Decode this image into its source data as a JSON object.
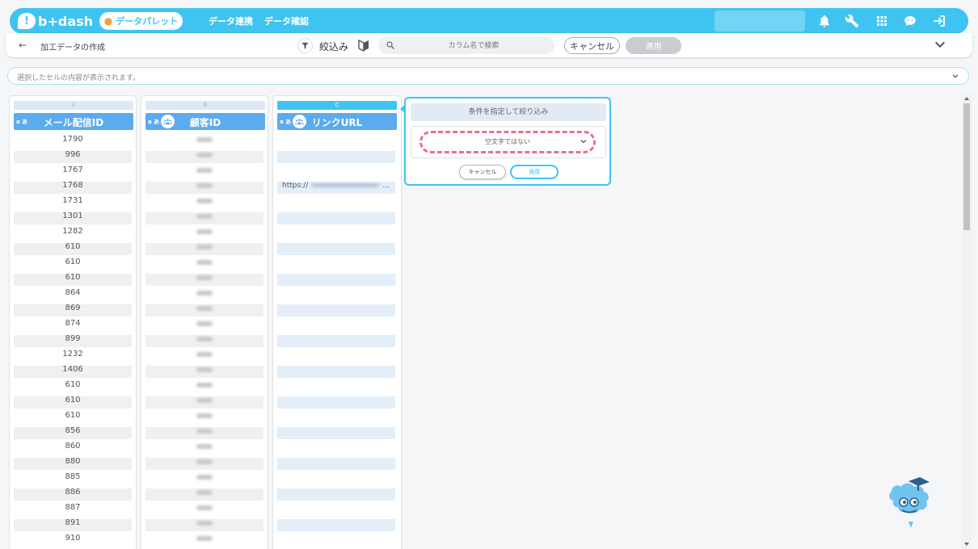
{
  "app": {
    "logo_text": "b+dash",
    "logo_mark": "!",
    "palette_label": "データパレット",
    "nav": [
      "データ連携",
      "データ確認"
    ]
  },
  "toolbar": {
    "page_title": "加工データの作成",
    "filter_label": "絞込み",
    "search_placeholder": "カラム名で検索",
    "cancel_label": "キャンセル",
    "apply_label": "適用"
  },
  "cell_bar": {
    "placeholder": "選択したセルの内容が表示されます。"
  },
  "columns": [
    {
      "letter": "A",
      "type_badge": "a あ",
      "name": "メール配信ID",
      "active": false
    },
    {
      "letter": "B",
      "type_badge": "a あ",
      "name": "顧客ID",
      "active": false
    },
    {
      "letter": "C",
      "type_badge": "a あ",
      "name": "リンクURL",
      "active": true
    }
  ],
  "column_a_values": [
    "1790",
    "996",
    "1767",
    "1768",
    "1731",
    "1301",
    "1282",
    "610",
    "610",
    "610",
    "864",
    "869",
    "874",
    "899",
    "1232",
    "1406",
    "610",
    "610",
    "610",
    "856",
    "860",
    "880",
    "885",
    "886",
    "887",
    "891",
    "910"
  ],
  "column_c_url_prefix": "https://",
  "column_c_url_suffix": "...",
  "filter_popup": {
    "title": "条件を指定して絞り込み",
    "condition": "空文字ではない",
    "cancel_label": "キャンセル",
    "apply_label": "適用"
  },
  "colors": {
    "accent": "#3fc4f2",
    "header_blue": "#5aabf0",
    "highlight_dash": "#f06e84"
  }
}
